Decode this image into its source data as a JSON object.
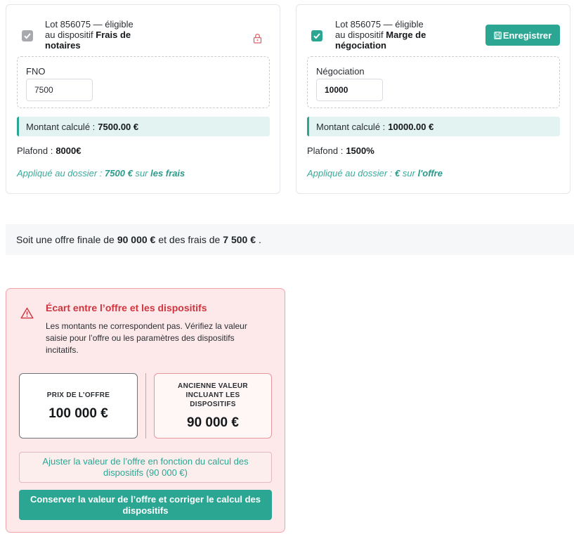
{
  "cards": [
    {
      "lot_prefix": "Lot 856075 — éligible au dispositif",
      "dispositif": "Frais de notaires",
      "field_label": "FNO",
      "field_value": "7500",
      "montant_label": "Montant calculé :",
      "montant_value": "7500.00 €",
      "plafond_label": "Plafond :",
      "plafond_value": "8000€",
      "applique_prefix": "Appliqué au dossier :",
      "applique_amount": "7500 €",
      "applique_mid": "sur",
      "applique_target": "les frais"
    },
    {
      "lot_prefix": "Lot 856075 — éligible au dispositif",
      "dispositif": "Marge de négociation",
      "save_label": "Enregistrer",
      "field_label": "Négociation",
      "field_value": "10000",
      "montant_label": "Montant calculé :",
      "montant_value": "10000.00 €",
      "plafond_label": "Plafond :",
      "plafond_value": "1500%",
      "applique_prefix": "Appliqué au dossier :",
      "applique_amount": "€",
      "applique_mid": "sur",
      "applique_target": "l'offre"
    }
  ],
  "summary": {
    "part1": "Soit une offre finale de",
    "offer": "90 000 €",
    "part2": "et des frais de",
    "fees": "7 500 €",
    "end": "."
  },
  "alert": {
    "title": "Écart entre l’offre et les dispositifs",
    "description": "Les montants ne correspondent pas. Vérifiez la valeur saisie pour l’offre ou les paramètres des dispositifs incitatifs.",
    "offer_caption": "PRIX DE L’OFFRE",
    "offer_value": "100 000 €",
    "old_caption": "ANCIENNE VALEUR INCLUANT LES DISPOSITIFS",
    "old_value": "90 000 €",
    "adjust_label": "Ajuster la valeur de l’offre en fonction du calcul des dispositifs (90 000 €)",
    "keep_label": "Conserver la valeur de l’offre et corriger le calcul des dispositifs"
  },
  "colors": {
    "accent": "#2aa693",
    "danger": "#d0343e",
    "alert_bg": "#fde9ea"
  },
  "icons": {
    "lock": "lock-icon",
    "save": "save-icon",
    "warning": "warning-icon",
    "check": "check-icon"
  }
}
